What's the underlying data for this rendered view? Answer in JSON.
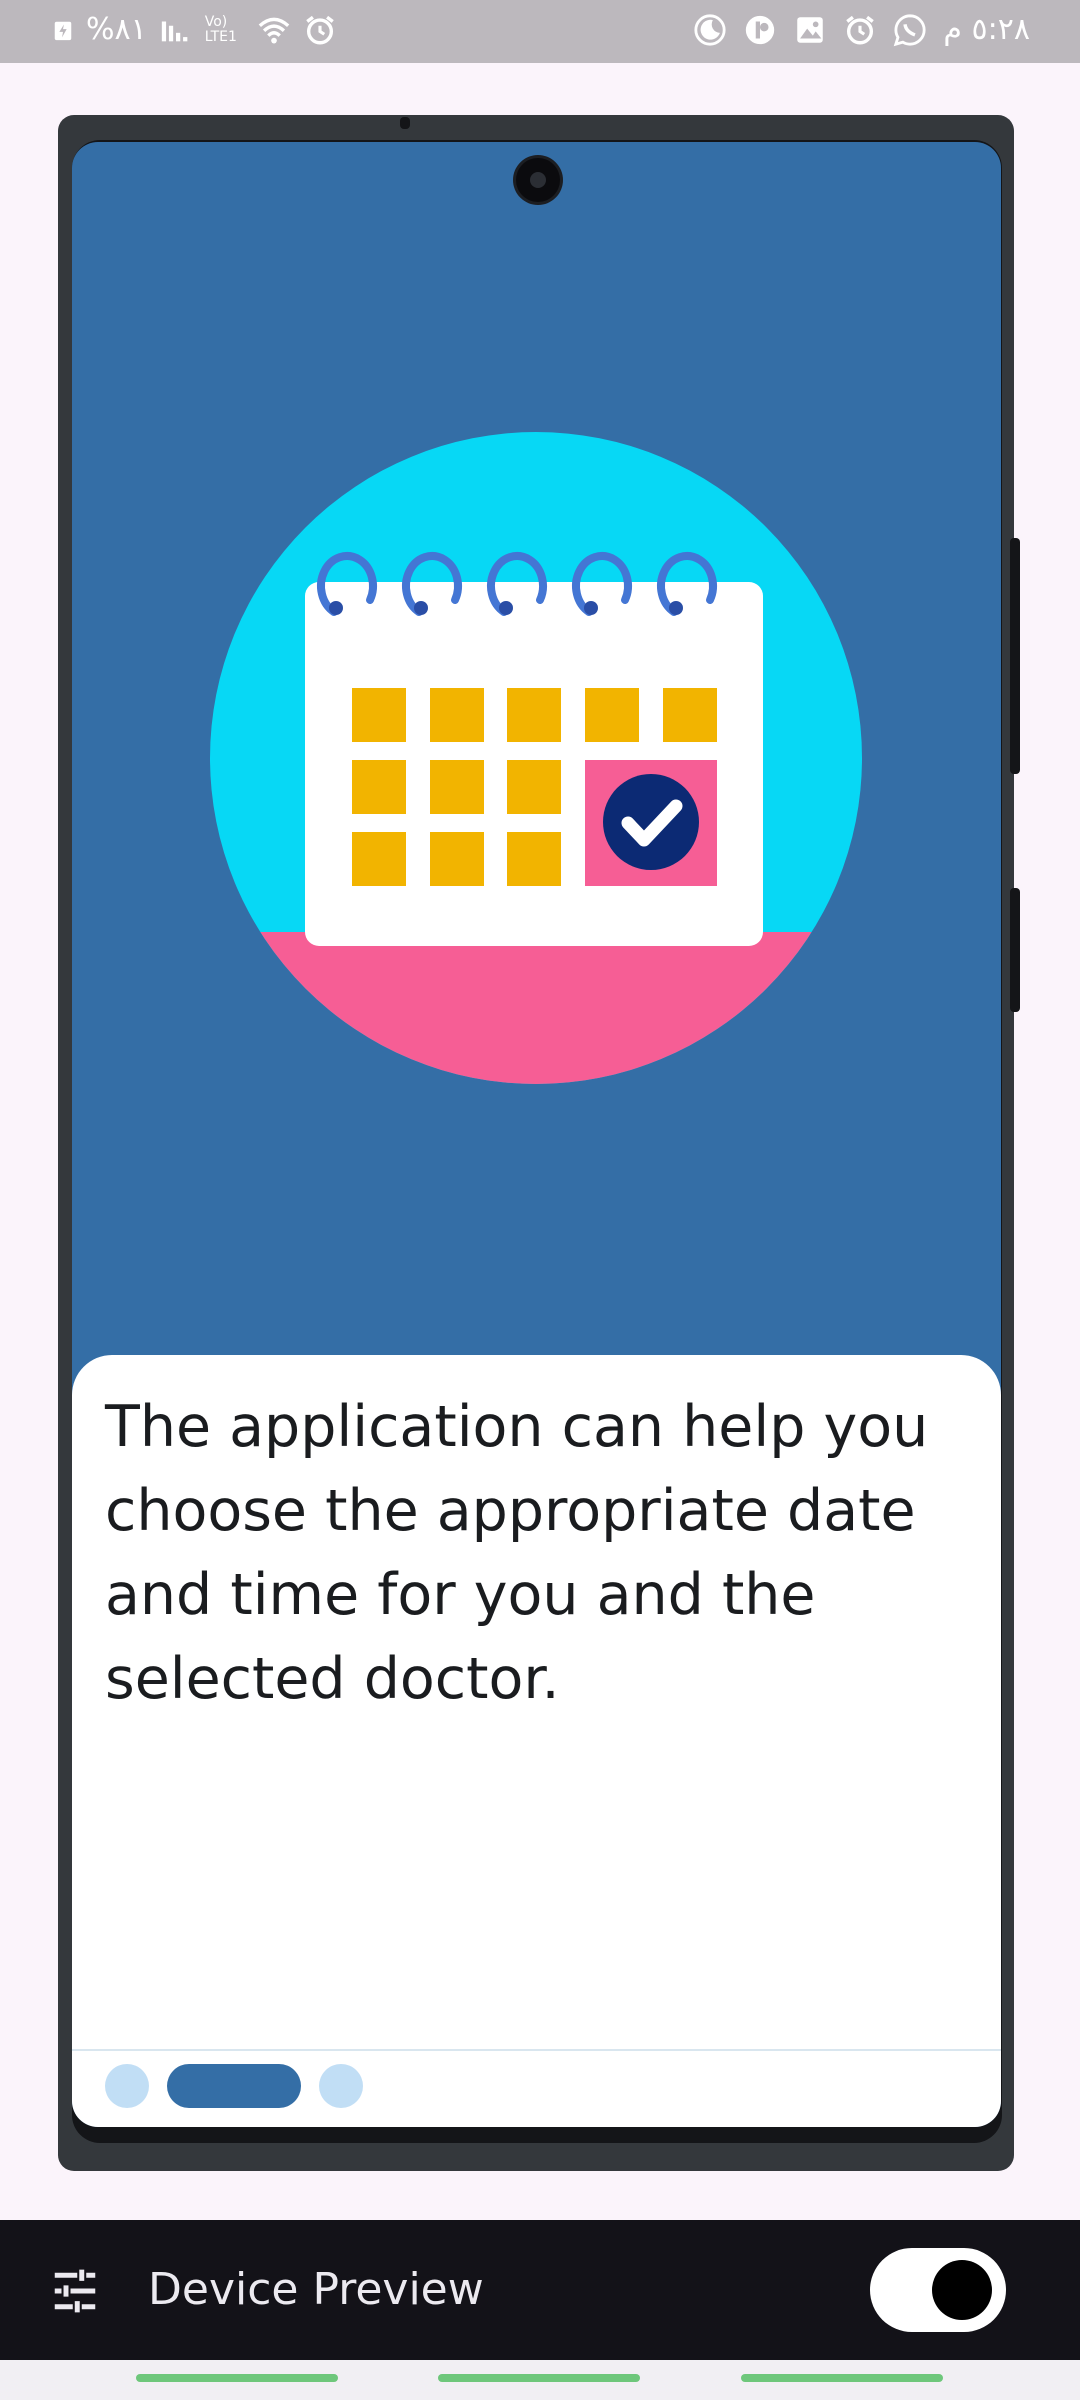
{
  "status_bar": {
    "battery_text": "%٨١",
    "network_text": "Vo) LTE1",
    "time_text": "٥:٢٨ م"
  },
  "onboarding": {
    "description": "The application can help you choose the appropriate date and time for you and the selected doctor.",
    "page_indicator": {
      "count": 3,
      "active_index": 1
    }
  },
  "toolbar": {
    "title": "Device Preview",
    "toggle_on": true
  },
  "colors": {
    "screen_bg": "#346ea6",
    "circle_cyan": "#07d8f5",
    "circle_pink": "#f65e95",
    "calendar_square": "#f2b400",
    "check_square": "#f65e95",
    "check_badge": "#0c2a74",
    "ring": "#4476d4",
    "dot_active": "#346ea6",
    "dot_inactive": "#c1def5"
  },
  "icons": [
    "battery-charging-icon",
    "signal-icon",
    "wifi-icon",
    "alarm-icon",
    "moon-icon",
    "app-icon",
    "image-icon",
    "whatsapp-icon",
    "tune-icon",
    "check-icon",
    "calendar-illustration"
  ]
}
